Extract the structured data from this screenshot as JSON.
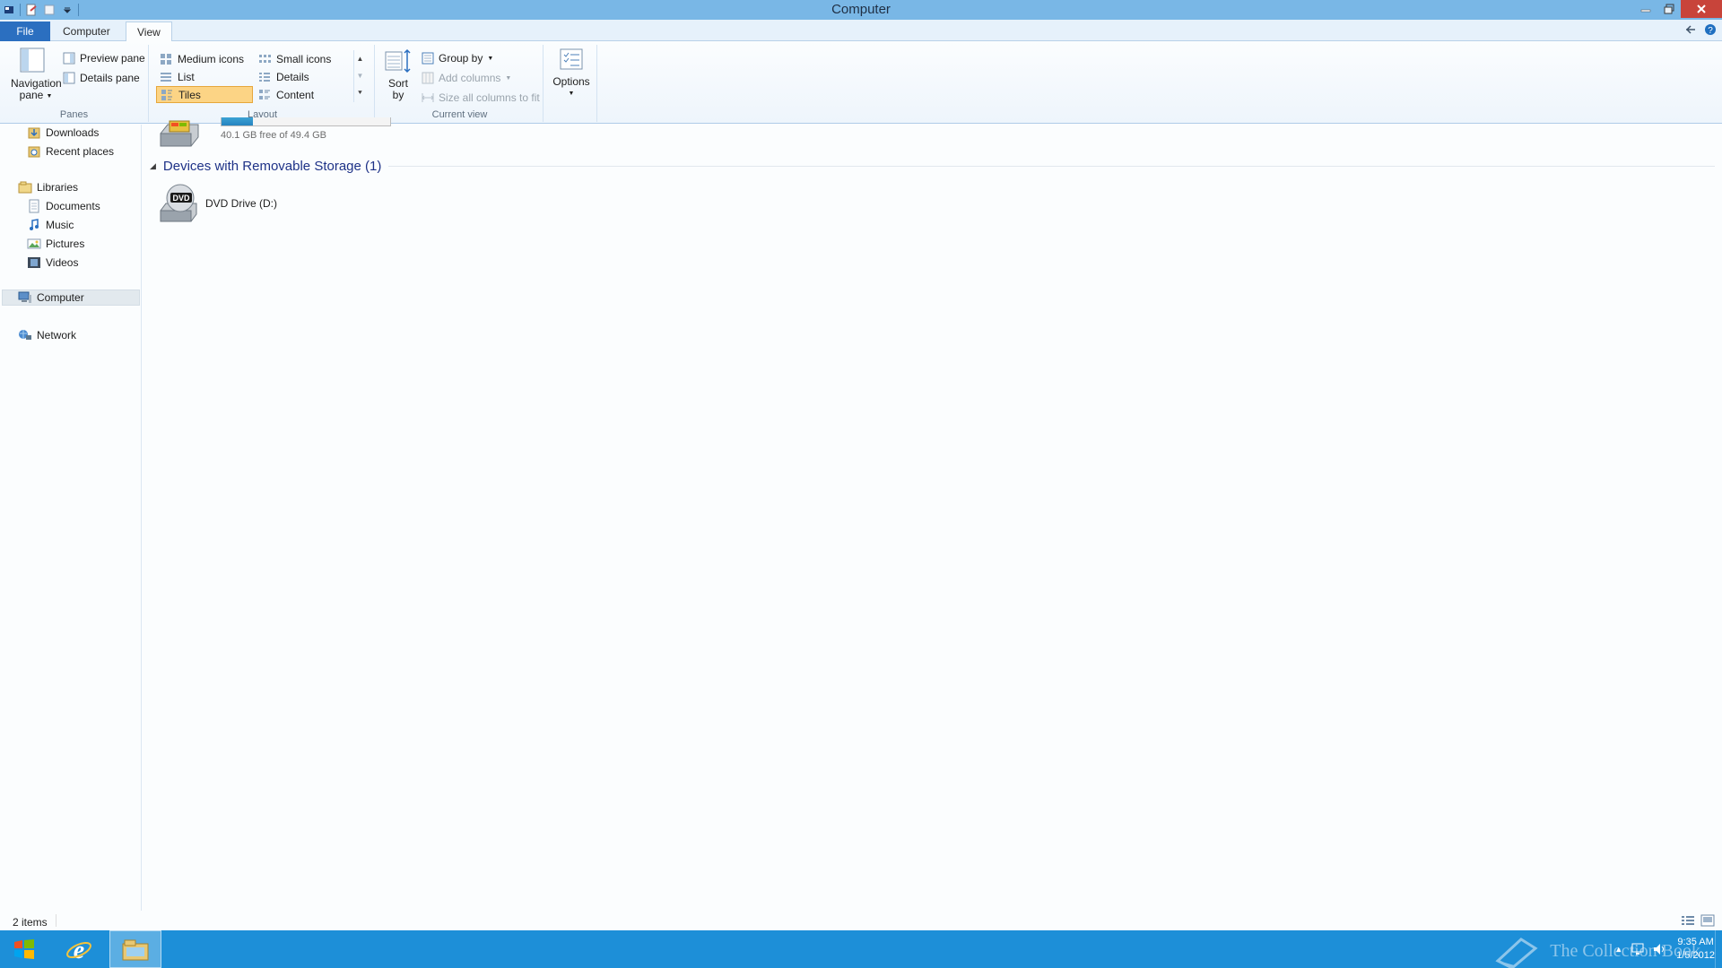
{
  "window": {
    "title": "Computer",
    "colors": {
      "titlebar": "#79b7e6",
      "file_tab": "#2b6fc0",
      "selected_layout": "#fcd485",
      "group_header": "#1e3287",
      "taskbar": "#1d8fd8"
    }
  },
  "ribbon": {
    "tabs": {
      "file": "File",
      "computer": "Computer",
      "view": "View"
    },
    "panes": {
      "label": "Panes",
      "navigation_pane": "Navigation pane",
      "preview_pane": "Preview pane",
      "details_pane": "Details pane"
    },
    "layout": {
      "label": "Layout",
      "selected": "Tiles",
      "items": {
        "medium_icons": "Medium icons",
        "small_icons": "Small icons",
        "list": "List",
        "details": "Details",
        "tiles": "Tiles",
        "content": "Content"
      }
    },
    "current_view": {
      "label": "Current view",
      "sort_by": "Sort by",
      "group_by": "Group by",
      "add_columns": "Add columns",
      "size_all_columns": "Size all columns to fit"
    },
    "options": "Options"
  },
  "nav": {
    "downloads": "Downloads",
    "recent_places": "Recent places",
    "libraries": "Libraries",
    "documents": "Documents",
    "music": "Music",
    "pictures": "Pictures",
    "videos": "Videos",
    "computer": "Computer",
    "network": "Network",
    "selected": "Computer"
  },
  "content": {
    "local_disk": {
      "free_text": "40.1 GB free of 49.4 GB",
      "used_fraction": 0.188
    },
    "removable_group": {
      "title": "Devices with Removable Storage (1)",
      "expanded": true
    },
    "dvd_drive": {
      "label": "DVD Drive (D:)",
      "icon_text": "DVD"
    }
  },
  "statusbar": {
    "item_count": "2 items"
  },
  "taskbar": {
    "time": "9:35 AM",
    "date": "1/5/2012",
    "watermark": "The Collection Book"
  }
}
